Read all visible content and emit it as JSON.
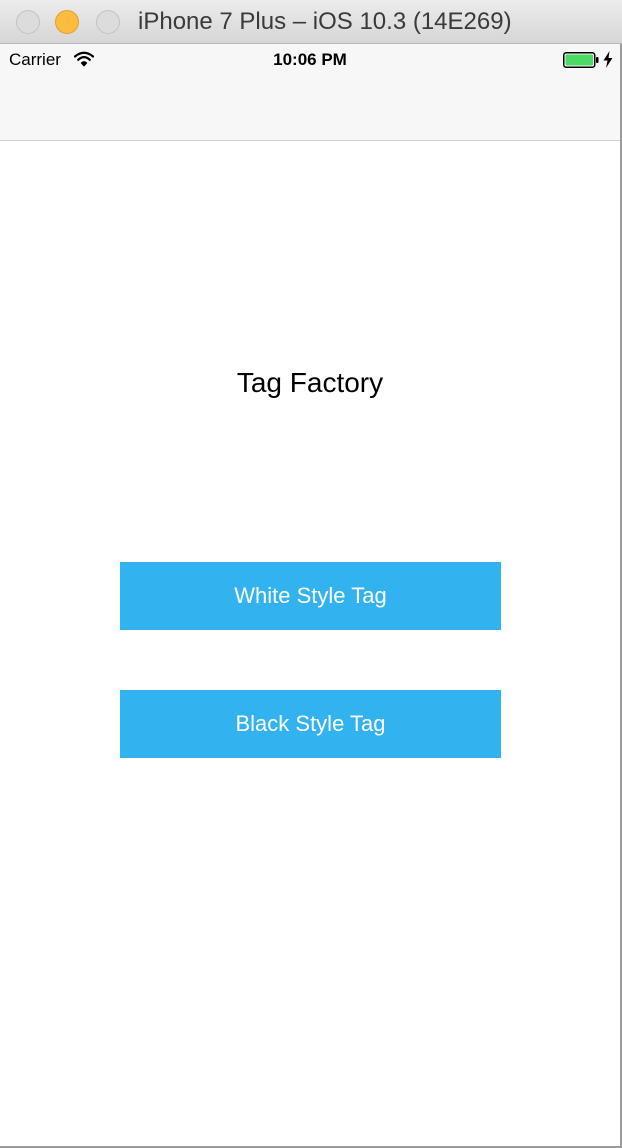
{
  "window": {
    "title": "iPhone 7 Plus – iOS 10.3 (14E269)"
  },
  "status_bar": {
    "carrier": "Carrier",
    "time": "10:06 PM",
    "icons": [
      "wifi-icon",
      "battery-icon",
      "charging-bolt-icon"
    ]
  },
  "main": {
    "title": "Tag Factory",
    "buttons": [
      {
        "label": "White Style Tag"
      },
      {
        "label": "Black Style Tag"
      }
    ]
  },
  "colors": {
    "button_background": "#32b3f0",
    "button_text": "#ffffff",
    "battery_fill": "#4cd964",
    "minimize_light": "#fdbc40"
  }
}
